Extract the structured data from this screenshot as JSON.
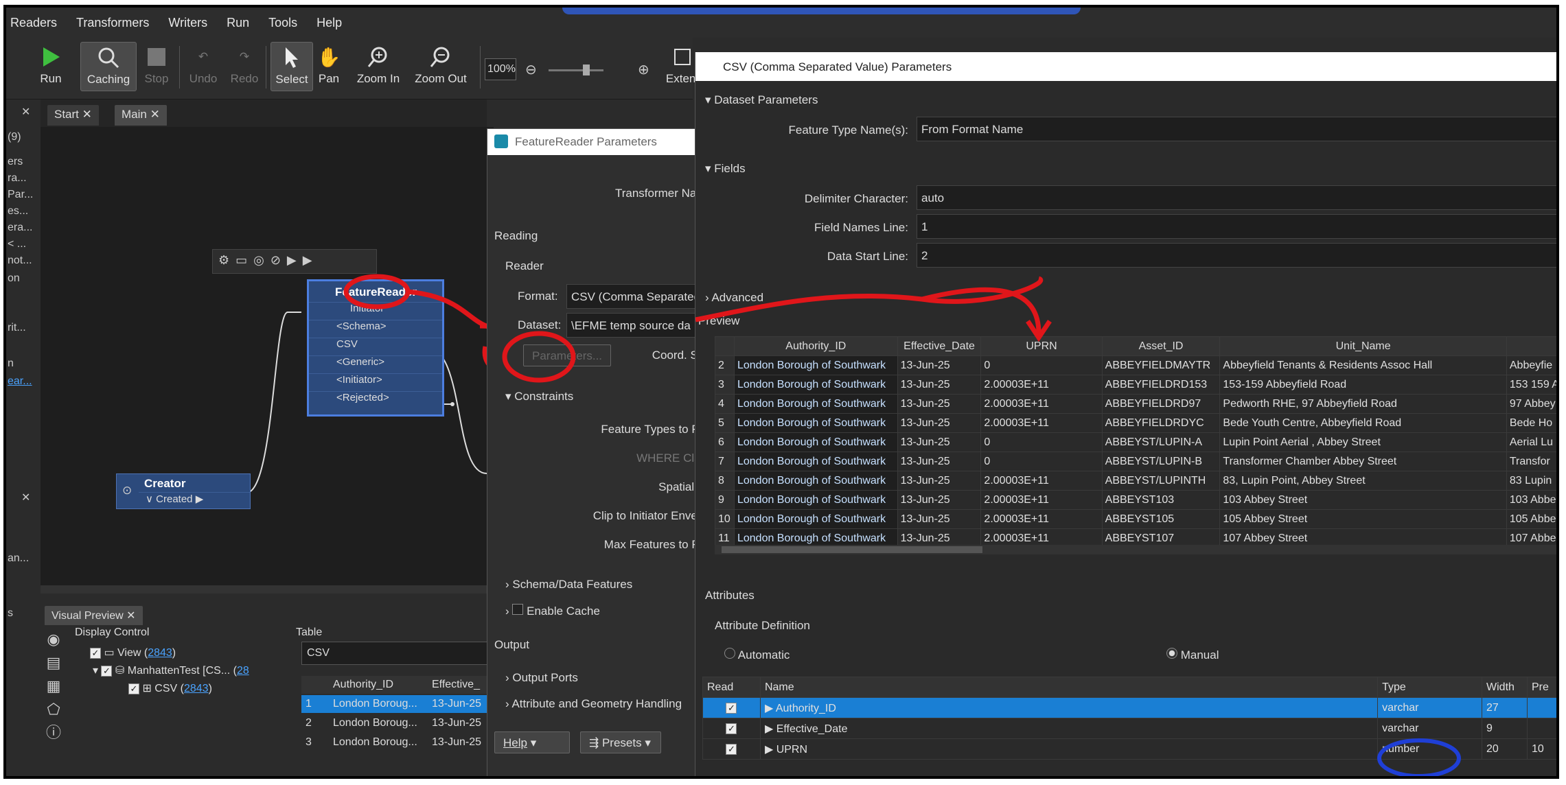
{
  "menu": [
    "Readers",
    "Transformers",
    "Writers",
    "Run",
    "Tools",
    "Help"
  ],
  "toolbar": {
    "run": "Run",
    "caching": "Caching",
    "stop": "Stop",
    "undo": "Undo",
    "redo": "Redo",
    "select": "Select",
    "pan": "Pan",
    "zoom_in": "Zoom In",
    "zoom_out": "Zoom Out",
    "zoom_level": "100%",
    "extent": "Extent"
  },
  "tabs": {
    "start": "Start",
    "main": "Main"
  },
  "left_panel": [
    "(9)",
    "ers",
    "ra...",
    "Par...",
    "es...",
    "era...",
    "< ...",
    "not...",
    "on",
    "rit...",
    "n",
    "ear..."
  ],
  "canvas": {
    "feature_reader": {
      "title": "FeatureReader",
      "ports": [
        "Initiator",
        "<Schema>",
        "CSV",
        "<Generic>",
        "<Initiator>",
        "<Rejected>"
      ]
    },
    "creator": {
      "title": "Creator",
      "port": "Created"
    }
  },
  "visual_preview": {
    "tab": "Visual Preview",
    "display_control": "Display Control",
    "table_label": "Table",
    "tree": [
      {
        "label": "View (",
        "count": "2843",
        "suffix": ")"
      },
      {
        "label": "ManhattenTest [CS... (",
        "count": "28",
        "suffix": ""
      },
      {
        "label": "CSV (",
        "count": "2843",
        "suffix": ")"
      }
    ],
    "table_select": "CSV",
    "columns": [
      "Authority_ID",
      "Effective_"
    ],
    "rows": [
      [
        "1",
        "London Boroug...",
        "13-Jun-25"
      ],
      [
        "2",
        "London Boroug...",
        "13-Jun-25"
      ],
      [
        "3",
        "London Boroug...",
        "13-Jun-25"
      ]
    ]
  },
  "feature_reader_dialog": {
    "title": "FeatureReader Parameters",
    "transformer_name": "Transformer Name",
    "reading": "Reading",
    "reader": "Reader",
    "format_label": "Format:",
    "format_value": "CSV (Comma Separated",
    "dataset_label": "Dataset:",
    "dataset_value": "\\EFME temp source da",
    "parameters_btn": "Parameters...",
    "coord": "Coord. Syste",
    "constraints": "Constraints",
    "feature_types": "Feature Types to Read",
    "where": "WHERE Clause",
    "spatial": "Spatial Filte",
    "clip": "Clip to Initiator Envelope",
    "max": "Max Features to Read",
    "schema": "Schema/Data Features",
    "cache": "Enable Cache",
    "output": "Output",
    "output_ports": "Output Ports",
    "attr_geom": "Attribute and Geometry Handling",
    "help": "Help",
    "presets": "Presets"
  },
  "csv_dialog": {
    "title": "CSV (Comma Separated Value) Parameters",
    "dataset_params": "Dataset Parameters",
    "feature_type_label": "Feature Type Name(s):",
    "feature_type_value": "From Format Name",
    "fields": "Fields",
    "delimiter_label": "Delimiter Character:",
    "delimiter_value": "auto",
    "names_line_label": "Field Names Line:",
    "names_line_value": "1",
    "start_line_label": "Data Start Line:",
    "start_line_value": "2",
    "advanced": "Advanced",
    "preview": "Preview",
    "preview_columns": [
      "Authority_ID",
      "Effective_Date",
      "UPRN",
      "Asset_ID",
      "Unit_Name",
      ""
    ],
    "preview_rows": [
      [
        "2",
        "London Borough of Southwark",
        "13-Jun-25",
        "0",
        "ABBEYFIELDMAYTR",
        "Abbeyfield Tenants & Residents Assoc Hall",
        "Abbeyfie"
      ],
      [
        "3",
        "London Borough of Southwark",
        "13-Jun-25",
        "2.00003E+11",
        "ABBEYFIELDRD153",
        "153-159 Abbeyfield Road",
        "153 159 A"
      ],
      [
        "4",
        "London Borough of Southwark",
        "13-Jun-25",
        "2.00003E+11",
        "ABBEYFIELDRD97",
        "Pedworth RHE, 97 Abbeyfield Road",
        "97 Abbey"
      ],
      [
        "5",
        "London Borough of Southwark",
        "13-Jun-25",
        "2.00003E+11",
        "ABBEYFIELDRDYC",
        "Bede Youth Centre, Abbeyfield Road",
        "Bede Ho"
      ],
      [
        "6",
        "London Borough of Southwark",
        "13-Jun-25",
        "0",
        "ABBEYST/LUPIN-A",
        "Lupin Point Aerial , Abbey Street",
        "Aerial Lu"
      ],
      [
        "7",
        "London Borough of Southwark",
        "13-Jun-25",
        "0",
        "ABBEYST/LUPIN-B",
        "Transformer Chamber Abbey Street",
        "Transfor"
      ],
      [
        "8",
        "London Borough of Southwark",
        "13-Jun-25",
        "2.00003E+11",
        "ABBEYST/LUPINTH",
        "83, Lupin Point, Abbey Street",
        "83 Lupin"
      ],
      [
        "9",
        "London Borough of Southwark",
        "13-Jun-25",
        "2.00003E+11",
        "ABBEYST103",
        "103 Abbey Street",
        "103 Abbe"
      ],
      [
        "10",
        "London Borough of Southwark",
        "13-Jun-25",
        "2.00003E+11",
        "ABBEYST105",
        "105 Abbey Street",
        "105 Abbe"
      ],
      [
        "11",
        "London Borough of Southwark",
        "13-Jun-25",
        "2.00003E+11",
        "ABBEYST107",
        "107 Abbey Street",
        "107 Abbe"
      ]
    ],
    "attributes": "Attributes",
    "attr_def": "Attribute Definition",
    "automatic": "Automatic",
    "manual": "Manual",
    "attr_columns": [
      "Read",
      "Name",
      "Type",
      "Width",
      "Pre"
    ],
    "attr_rows": [
      {
        "name": "Authority_ID",
        "type": "varchar",
        "width": "27",
        "prec": ""
      },
      {
        "name": "Effective_Date",
        "type": "varchar",
        "width": "9",
        "prec": ""
      },
      {
        "name": "UPRN",
        "type": "number",
        "width": "20",
        "prec": "10"
      }
    ]
  },
  "colors": {
    "annotation_red": "#e0161a",
    "annotation_blue": "#1f3fd6",
    "selection": "#1a7fd4"
  }
}
